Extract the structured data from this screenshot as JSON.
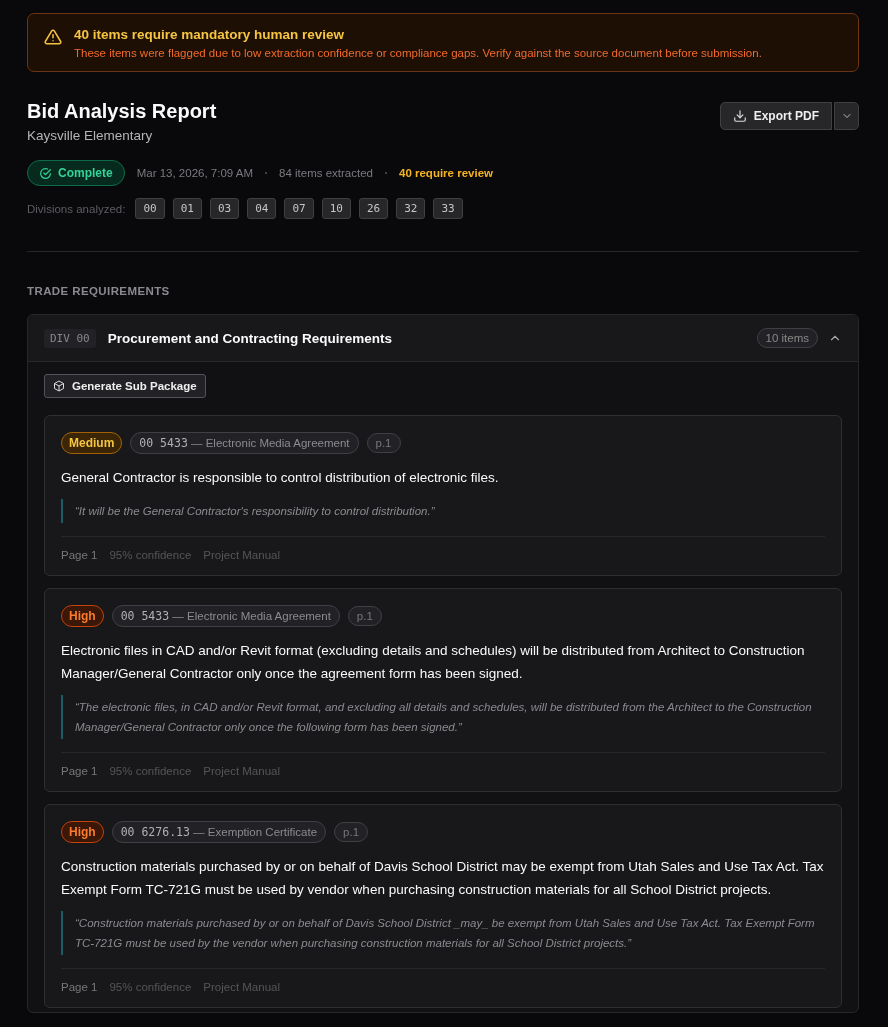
{
  "alert": {
    "title": "40 items require mandatory human review",
    "message": "These items were flagged due to low extraction confidence or compliance gaps. Verify against the source document before submission."
  },
  "report": {
    "title": "Bid Analysis Report",
    "subtitle": "Kaysville Elementary",
    "export_label": "Export PDF"
  },
  "status": {
    "label": "Complete",
    "date": "Mar 13, 2026, 7:09 AM",
    "extracted": "84 items extracted",
    "review": "40 require review"
  },
  "divisions": {
    "label": "Divisions analyzed:",
    "codes": [
      "00",
      "01",
      "03",
      "04",
      "07",
      "10",
      "26",
      "32",
      "33"
    ]
  },
  "section_heading": "TRADE REQUIREMENTS",
  "division_panel": {
    "code": "DIV 00",
    "title": "Procurement and Contracting Requirements",
    "count": "10 items",
    "expanded": true,
    "action": "Generate Sub Package",
    "items": [
      {
        "severity": {
          "kind": "medium",
          "label": "Medium"
        },
        "section": "00 5433",
        "section_title": "— Electronic Media Agreement",
        "page_tag": "p.1",
        "summary": "General Contractor is responsible to control distribution of electronic files.",
        "quote": "“It will be the General Contractor's responsibility to control distribution.”",
        "page": "Page 1",
        "confidence": "95% confidence",
        "source": "Project Manual"
      },
      {
        "severity": {
          "kind": "high",
          "label": "High"
        },
        "section": "00 5433",
        "section_title": "— Electronic Media Agreement",
        "page_tag": "p.1",
        "summary": "Electronic files in CAD and/or Revit format (excluding details and schedules) will be distributed from Architect to Construction Manager/General Contractor only once the agreement form has been signed.",
        "quote": "“The electronic files, in CAD and/or Revit format, and excluding all details and schedules, will be distributed from the Architect to the Construction Manager/General Contractor only once the following form has been signed.”",
        "page": "Page 1",
        "confidence": "95% confidence",
        "source": "Project Manual"
      },
      {
        "severity": {
          "kind": "high",
          "label": "High"
        },
        "section": "00 6276.13",
        "section_title": "— Exemption Certificate",
        "page_tag": "p.1",
        "summary": "Construction materials purchased by or on behalf of Davis School District may be exempt from Utah Sales and Use Tax Act. Tax Exempt Form TC-721G must be used by vendor when purchasing construction materials for all School District projects.",
        "quote": "“Construction materials purchased by or on behalf of Davis School District _may_ be exempt from Utah Sales and Use Tax Act. Tax Exempt Form TC-721G must be used by the vendor when purchasing construction materials for all School District projects.”",
        "page": "Page 1",
        "confidence": "95% confidence",
        "source": "Project Manual"
      }
    ]
  }
}
